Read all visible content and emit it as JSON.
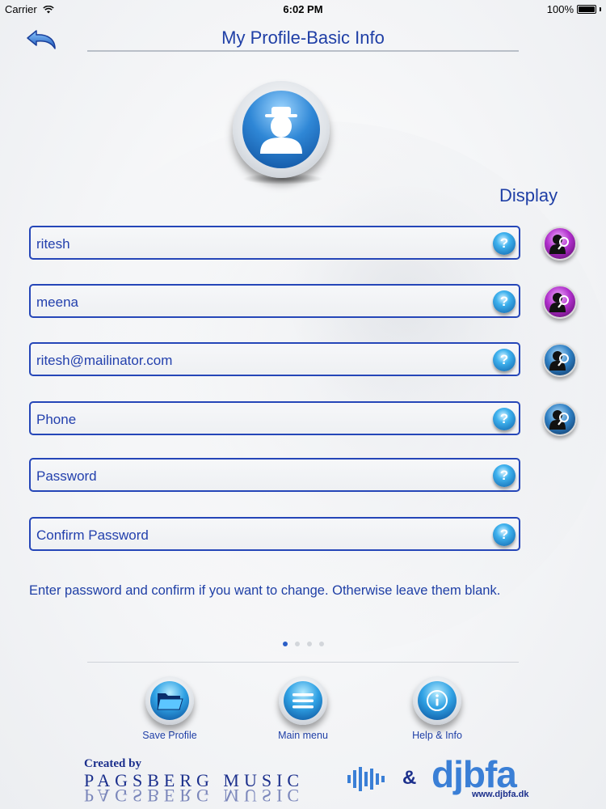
{
  "status_bar": {
    "carrier": "Carrier",
    "time": "6:02 PM",
    "battery": "100%"
  },
  "header": {
    "title": "My Profile-Basic Info"
  },
  "display_label": "Display",
  "fields": [
    {
      "value": "ritesh",
      "display": "on"
    },
    {
      "value": "meena",
      "display": "on"
    },
    {
      "value": "ritesh@mailinator.com",
      "display": "off"
    },
    {
      "placeholder": "Phone",
      "display": "off"
    },
    {
      "placeholder": "Password"
    },
    {
      "placeholder": "Confirm Password"
    }
  ],
  "hint": "Enter password and confirm if you want to change. Otherwise leave them blank.",
  "pager": {
    "total": 4,
    "active": 1
  },
  "toolbar": {
    "save_label": "Save Profile",
    "menu_label": "Main menu",
    "help_label": "Help & Info"
  },
  "credit": {
    "created_by": "Created by",
    "pagsberg": "PAGSBERG MUSIC",
    "amp": "&",
    "djbfa": "djbfa",
    "djbfa_url": "www.djbfa.dk"
  },
  "colors": {
    "accent": "#1f3fa6",
    "field_border": "#2546b8",
    "display_on": "#b02fcc",
    "display_off": "#2f80c4"
  },
  "help_glyph": "?"
}
